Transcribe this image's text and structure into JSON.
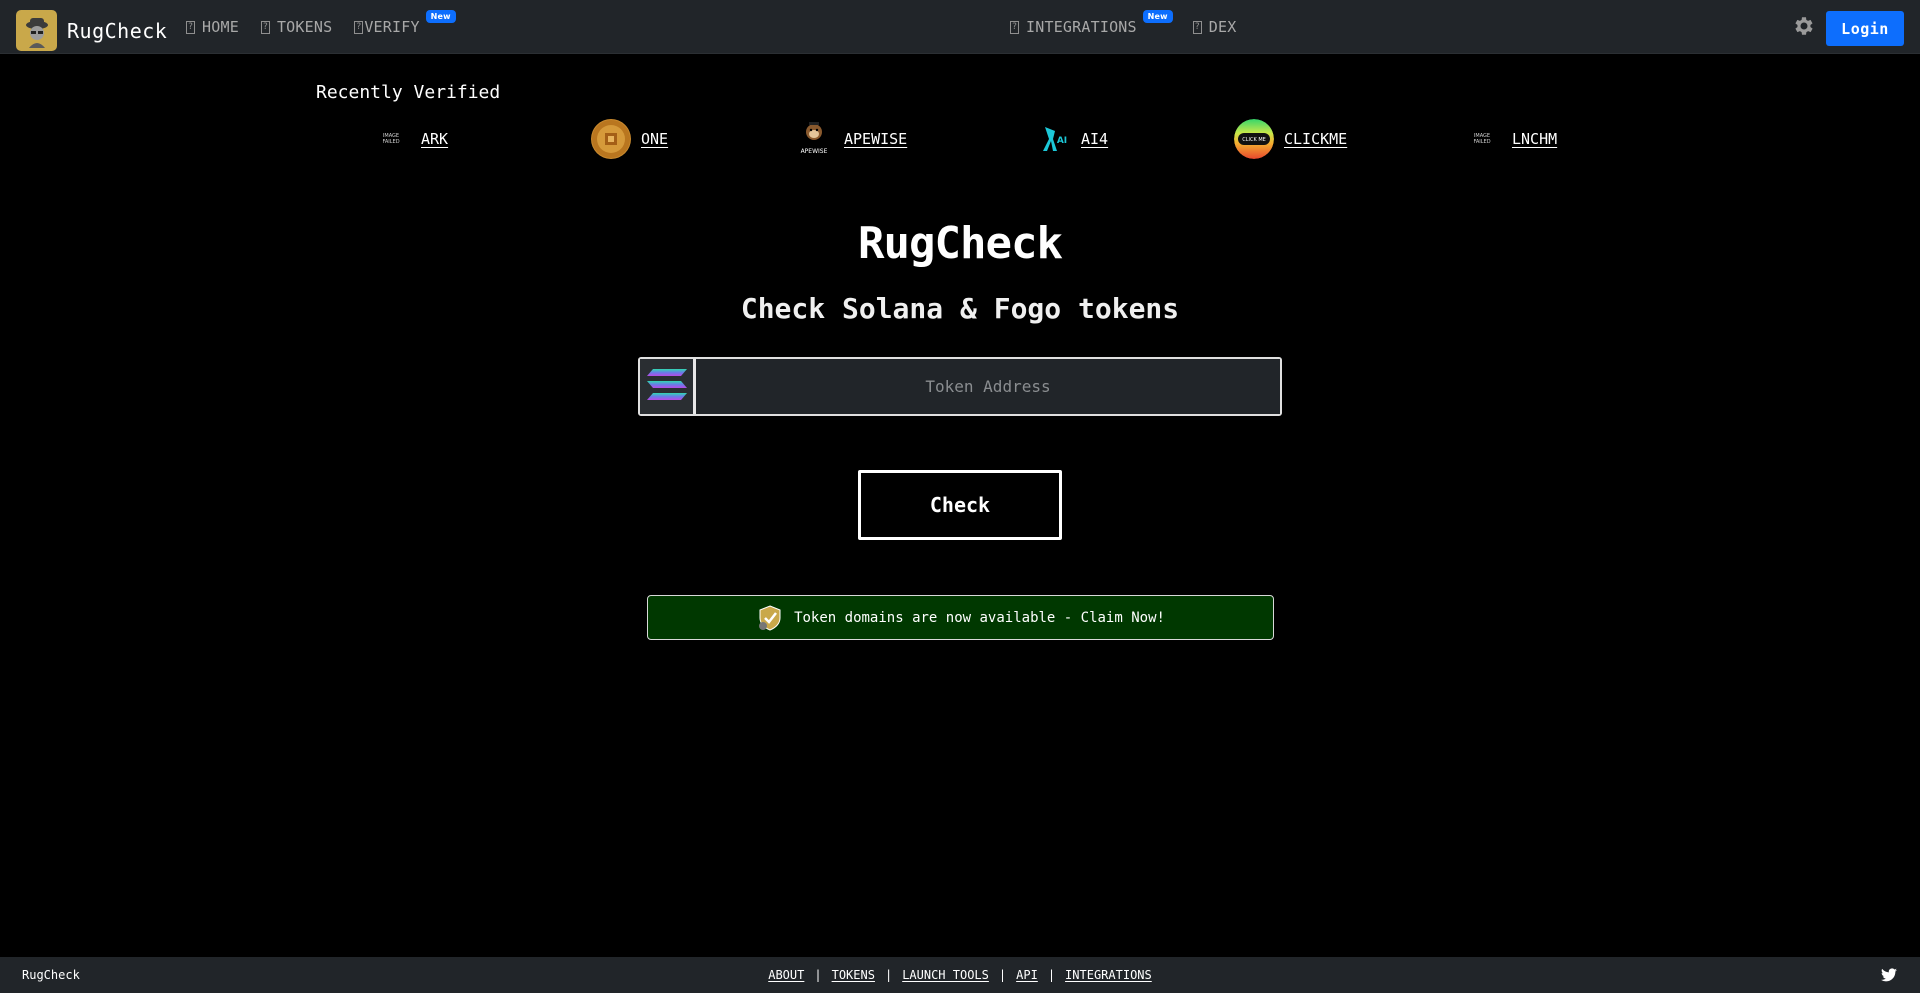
{
  "navbar": {
    "brand": "RugCheck",
    "items": [
      {
        "label": "HOME",
        "icon": "home-icon"
      },
      {
        "label": "TOKENS",
        "icon": "tokens-icon"
      },
      {
        "label": "VERIFY",
        "icon": "verify-icon",
        "badge": "New"
      },
      {
        "label": "INTEGRATIONS",
        "icon": "integrations-icon",
        "badge": "New"
      },
      {
        "label": "DEX",
        "icon": "dex-icon"
      }
    ],
    "login_label": "Login",
    "accent": "#0d6efd"
  },
  "recent": {
    "title": "Recently Verified",
    "tokens": [
      {
        "name": "ARK",
        "image": "no-image"
      },
      {
        "name": "ONE",
        "image": "gold-coin"
      },
      {
        "name": "APEWISE",
        "image": "ape-logo"
      },
      {
        "name": "AI4",
        "image": "ai-logo"
      },
      {
        "name": "CLICKME",
        "image": "rainbow-click-me"
      },
      {
        "name": "LNCHM",
        "image": "no-image"
      }
    ],
    "no_image_text": "IMAGE FAILED"
  },
  "hero": {
    "title": "RugCheck",
    "subtitle": "Check Solana & Fogo tokens"
  },
  "search": {
    "placeholder": "Token Address",
    "value": "",
    "chain_icon": "solana-icon"
  },
  "check_label": "Check",
  "promo": {
    "text": "Token domains are now available - Claim Now!",
    "background": "#003800"
  },
  "footer": {
    "brand": "RugCheck",
    "links": [
      "ABOUT",
      "TOKENS",
      "LAUNCH TOOLS",
      "API",
      "INTEGRATIONS"
    ],
    "separator": "|"
  }
}
